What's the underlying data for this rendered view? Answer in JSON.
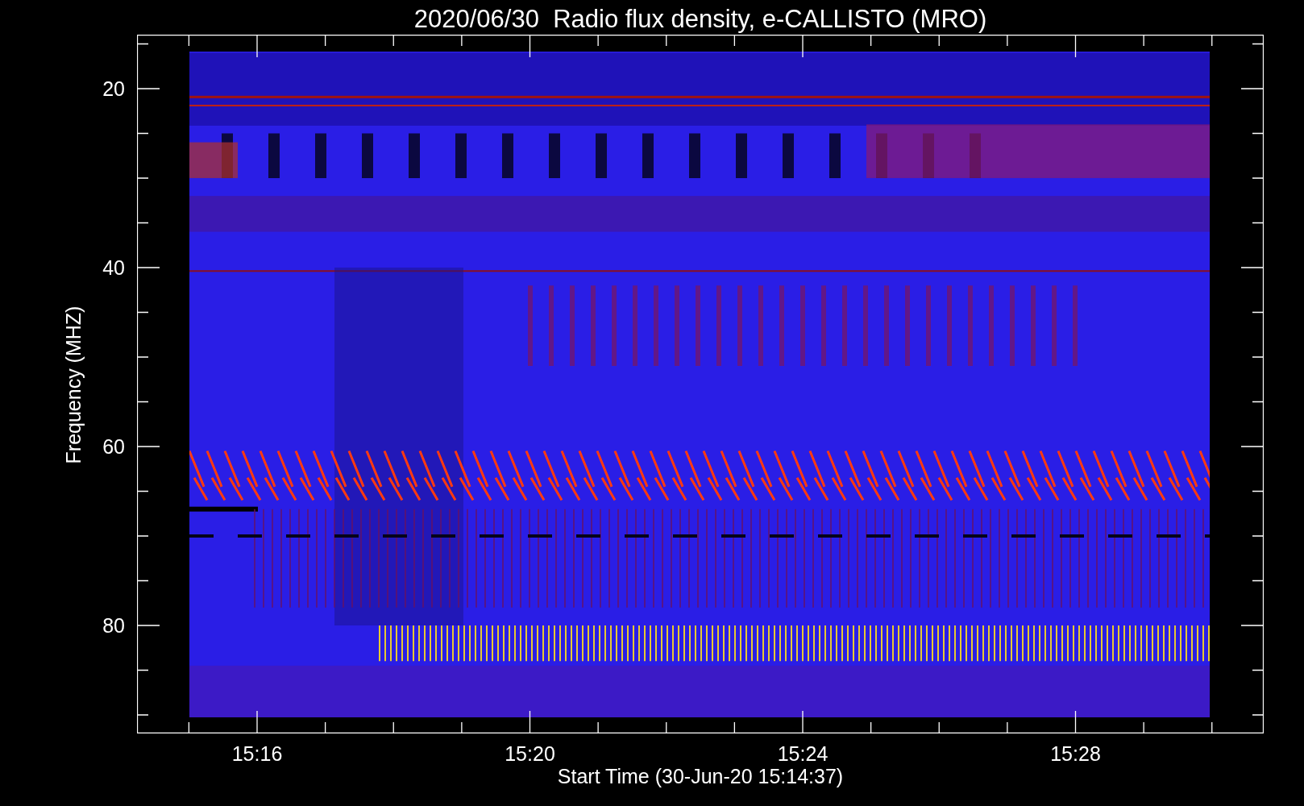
{
  "title": "2020/06/30  Radio flux density, e-CALLISTO (MRO)",
  "y_axis": {
    "label": "Frequency (MHZ)",
    "ticks": [
      "20",
      "40",
      "60",
      "80"
    ]
  },
  "x_axis": {
    "label": "Start Time (30-Jun-20 15:14:37)",
    "ticks": [
      "15:16",
      "15:20",
      "15:24",
      "15:28"
    ]
  }
}
